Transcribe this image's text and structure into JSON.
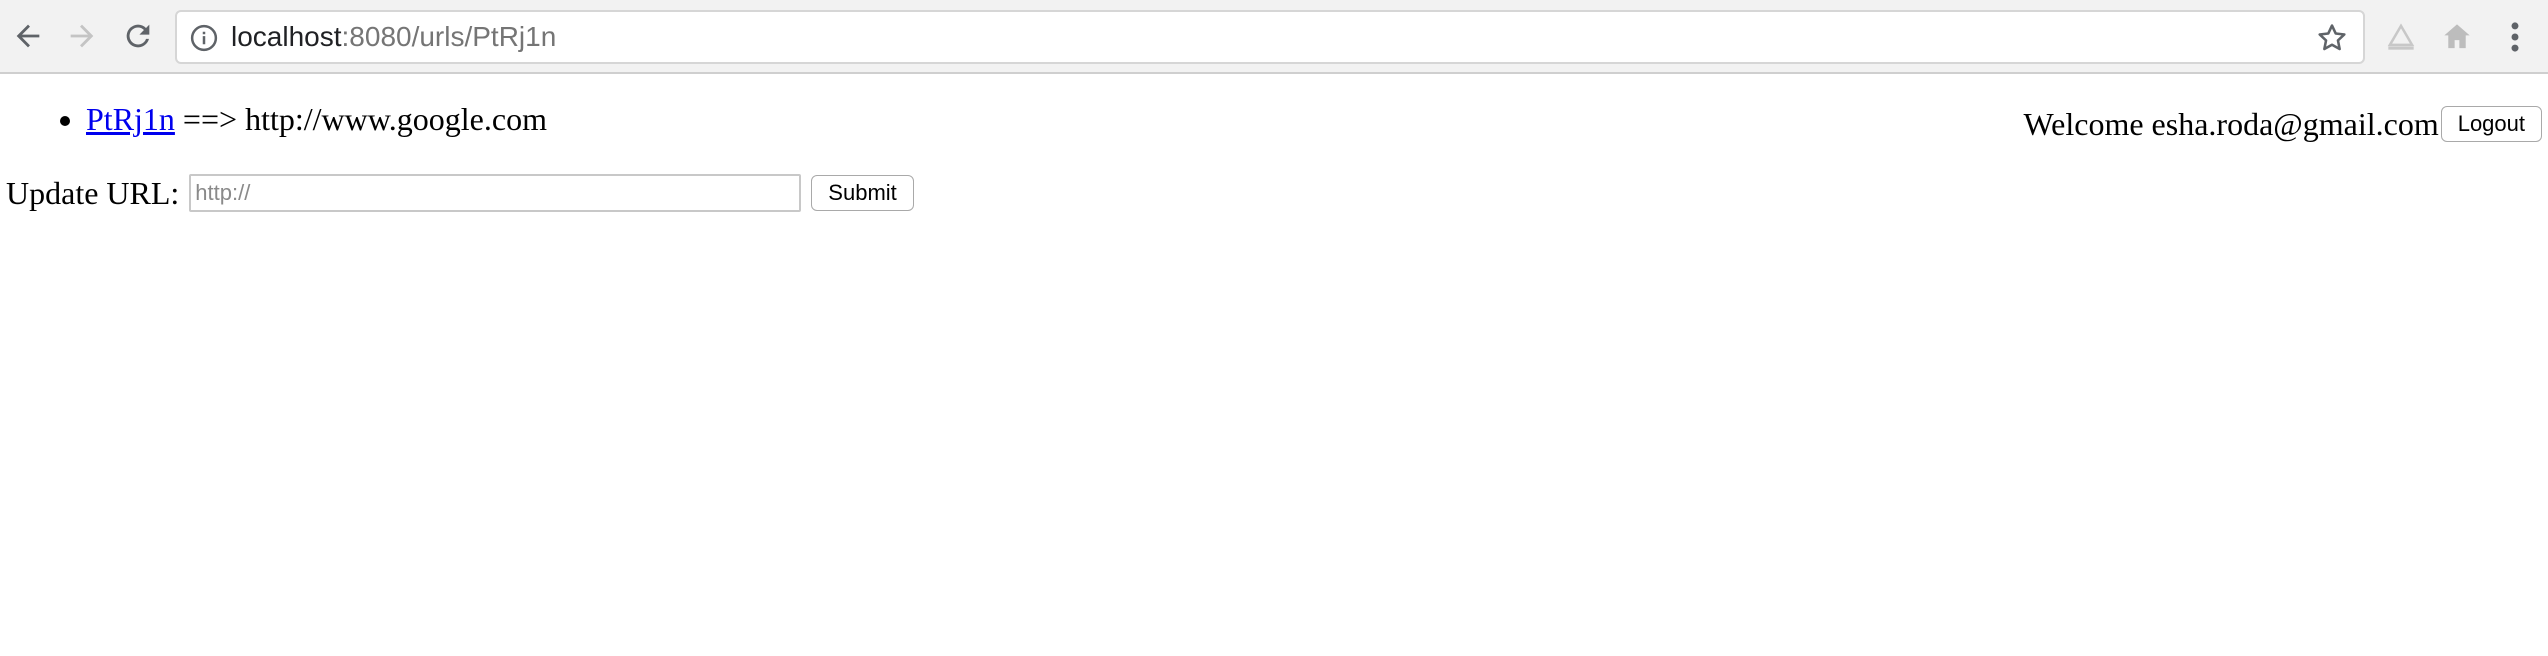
{
  "browser": {
    "url_host": "localhost",
    "url_rest": ":8080/urls/PtRj1n",
    "icons": {
      "back": "back-arrow-icon",
      "forward": "forward-arrow-icon",
      "reload": "reload-icon",
      "info": "info-icon",
      "bookmark": "star-icon",
      "extension1": "extension-icon",
      "extension2": "home-icon",
      "menu": "kebab-menu-icon"
    }
  },
  "urls": [
    {
      "short": "PtRj1n",
      "arrow": " ==> ",
      "long": "http://www.google.com"
    }
  ],
  "header": {
    "welcome": "Welcome esha.roda@gmail.com",
    "logout_label": "Logout"
  },
  "update_form": {
    "label": "Update URL:",
    "placeholder": "http://",
    "value": "",
    "submit_label": "Submit"
  },
  "colors": {
    "link": "#0000ee",
    "chrome_bg": "#f2f2f2"
  }
}
